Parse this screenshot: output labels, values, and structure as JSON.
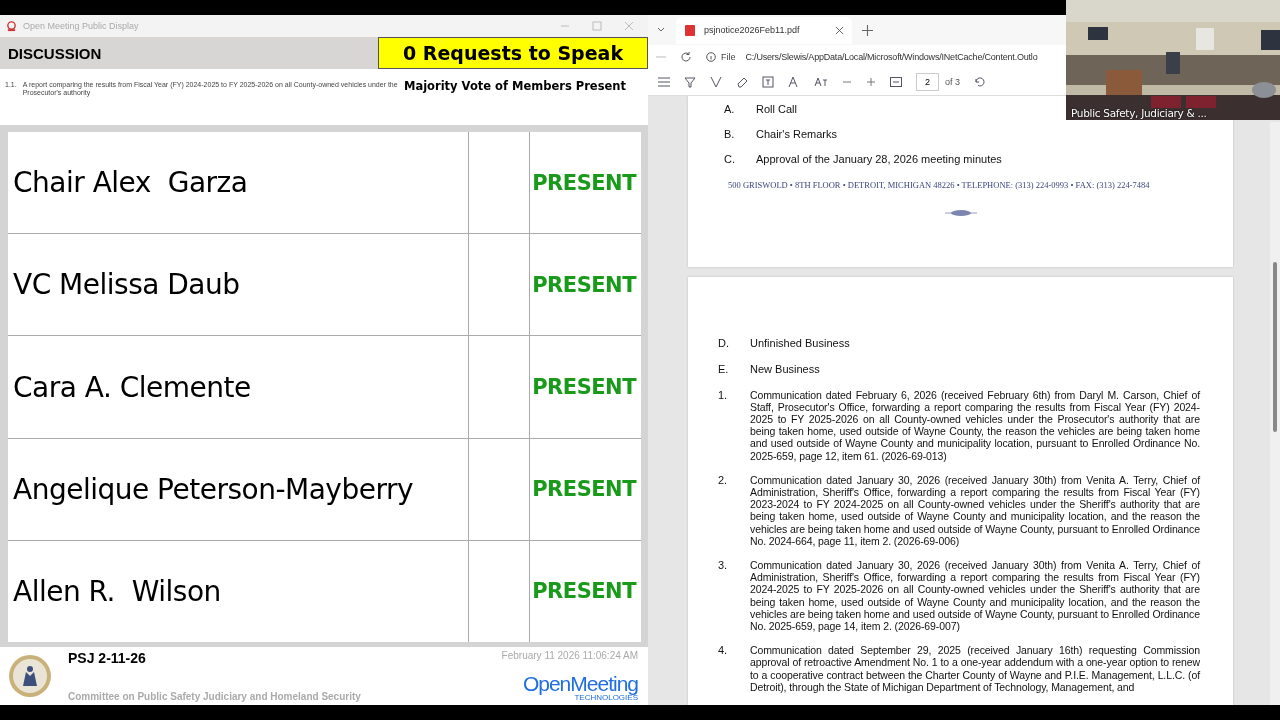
{
  "display_window": {
    "title": "Open Meeting Public Display",
    "section": "DISCUSSION",
    "requests": "0 Requests to Speak",
    "item_number": "1.1.",
    "item_text": "A report comparing the results from Fiscal Year (FY) 2024-2025 to FY 2025-2026 on all County-owned vehicles under the Prosecutor's authority",
    "vote_rule": "Majority Vote of Members Present"
  },
  "members": [
    {
      "name": "Chair Alex  Garza",
      "status": "PRESENT"
    },
    {
      "name": "VC Melissa Daub",
      "status": "PRESENT"
    },
    {
      "name": "Cara A. Clemente",
      "status": "PRESENT"
    },
    {
      "name": "Angelique Peterson-Mayberry",
      "status": "PRESENT"
    },
    {
      "name": "Allen R.  Wilson",
      "status": "PRESENT"
    }
  ],
  "footer": {
    "meeting": "PSJ 2-11-26",
    "committee": "Committee on Public Safety Judiciary and Homeland Security",
    "timestamp": "February 11 2026 11:06:24 AM",
    "logo": "OpenMeeting",
    "logo_sub": "TECHNOLOGIES"
  },
  "browser": {
    "tab": "psjnotice2026Feb11.pdf",
    "scheme": "File",
    "address": "C:/Users/Slewis/AppData/Local/Microsoft/Windows/INetCache/Content.Outlo",
    "page": "2",
    "page_count": "of 3"
  },
  "pdf_page_1": {
    "items": [
      {
        "mark": "A.",
        "text": "Roll Call"
      },
      {
        "mark": "B.",
        "text": "Chair's Remarks"
      },
      {
        "mark": "C.",
        "text": "Approval of the January 28, 2026 meeting minutes"
      }
    ],
    "address_line": "500 GRISWOLD • 8TH FLOOR • DETROIT, MICHIGAN 48226 • TELEPHONE: (313) 224-0993 • FAX: (313) 224-7484"
  },
  "pdf_page_2": {
    "sections": [
      {
        "mark": "D.",
        "text": "Unfinished Business"
      },
      {
        "mark": "E.",
        "text": "New Business"
      }
    ],
    "items": [
      {
        "mark": "1.",
        "text": "Communication dated February 6, 2026 (received February 6th) from Daryl M. Carson, Chief of Staff, Prosecutor's Office, forwarding a report comparing the results from Fiscal Year (FY) 2024-2025 to FY 2025-2026 on all County-owned vehicles under the Prosecutor's authority that are being taken home, used outside of Wayne County, the reason the vehicles are being taken home and used outside of Wayne County and municipality location, pursuant to Enrolled Ordinance No. 2025-659, page 12, item 61. (2026-69-013)"
      },
      {
        "mark": "2.",
        "text": "Communication dated January 30, 2026 (received January 30th) from Venita A. Terry, Chief of Administration, Sheriff's Office, forwarding a report comparing the results from Fiscal Year (FY) 2023-2024 to FY 2024-2025 on all County-owned vehicles under the Sheriff's authority that are being taken home, used outside of Wayne County and municipality location, and the reason the vehicles are being taken home and used outside of Wayne County, pursuant to Enrolled Ordinance No. 2024-664, page 11, item 2. (2026-69-006)"
      },
      {
        "mark": "3.",
        "text": "Communication dated January 30, 2026 (received January 30th) from Venita A. Terry, Chief of Administration, Sheriff's Office, forwarding a report comparing the results from Fiscal Year (FY) 2024-2025 to FY 2025-2026 on all County-owned vehicles under the Sheriff's authority that are being taken home, used outside of Wayne County and municipality location, and the reason the vehicles are being taken home and used outside of Wayne County, pursuant to Enrolled Ordinance No. 2025-659, page 14, item 2. (2026-69-007)"
      },
      {
        "mark": "4.",
        "text": "Communication dated September 29, 2025 (received January 16th) requesting Commission approval of retroactive Amendment No. 1 to a one-year addendum with a one-year option to renew to a cooperative contract between the Charter County of Wayne and P.I.E. Management, L.L.C. (of Detroit), through the State of Michigan Department of Technology, Management, and"
      }
    ]
  },
  "video": {
    "caption": "Public Safety, Judiciary & ..."
  }
}
